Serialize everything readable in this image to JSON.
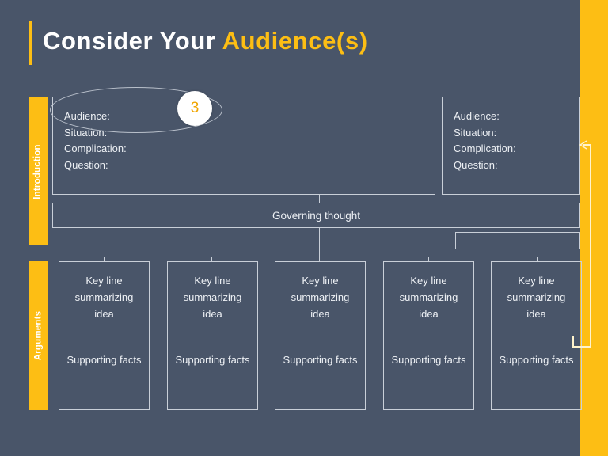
{
  "slide": {
    "background_color": "#495569",
    "accent_color": "#fdbe14",
    "line_color": "#c9cfd8"
  },
  "header": {
    "title_main": "Consider Your ",
    "title_accent": "Audience(s)"
  },
  "sidebar": {
    "sections": [
      {
        "label": "Introduction"
      },
      {
        "label": "Arguments"
      }
    ]
  },
  "introduction": {
    "left_box": {
      "lines": [
        "Audience:",
        "Situation:",
        "Complication:",
        "Question:"
      ]
    },
    "right_box": {
      "lines": [
        "Audience:",
        "Situation:",
        "Complication:",
        "Question:"
      ]
    }
  },
  "governing": {
    "label": "Governing thought"
  },
  "arguments": {
    "columns": [
      {
        "key_line": "Key line summarizing idea",
        "supporting": "Supporting facts"
      },
      {
        "key_line": "Key line summarizing idea",
        "supporting": "Supporting facts"
      },
      {
        "key_line": "Key line summarizing idea",
        "supporting": "Supporting facts"
      },
      {
        "key_line": "Key line summarizing idea",
        "supporting": "Supporting facts"
      },
      {
        "key_line": "Key line summarizing idea",
        "supporting": "Supporting facts"
      }
    ]
  },
  "annotation": {
    "badge_number": "3",
    "badge_color": "#f0a500"
  }
}
